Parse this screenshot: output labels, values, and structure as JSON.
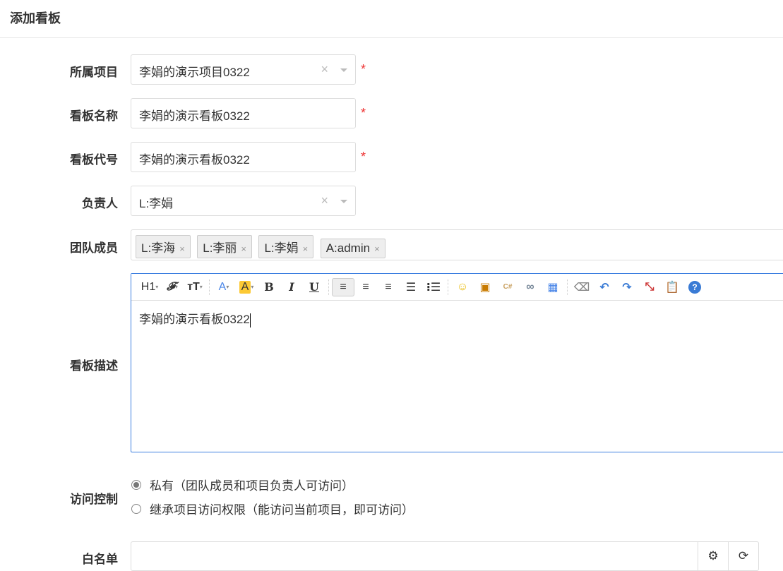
{
  "header": {
    "title": "添加看板"
  },
  "form": {
    "project": {
      "label": "所属项目",
      "value": "李娟的演示项目0322",
      "required": "*"
    },
    "name": {
      "label": "看板名称",
      "value": "李娟的演示看板0322",
      "required": "*"
    },
    "code": {
      "label": "看板代号",
      "value": "李娟的演示看板0322",
      "required": "*"
    },
    "owner": {
      "label": "负责人",
      "value": "L:李娟"
    },
    "team": {
      "label": "团队成员",
      "members": [
        "L:李海",
        "L:李丽",
        "L:李娟",
        "A:admin"
      ]
    },
    "description": {
      "label": "看板描述",
      "value": "李娟的演示看板0322",
      "toolbar": {
        "heading": "H1",
        "font": "𝓕",
        "size": "ᴛT",
        "color": "A",
        "bg": "A",
        "bold": "B",
        "italic": "I",
        "underline": "U"
      }
    },
    "access": {
      "label": "访问控制",
      "options": [
        "私有（团队成员和项目负责人可访问）",
        "继承项目访问权限（能访问当前项目，即可访问）"
      ],
      "selected": 0
    },
    "whitelist": {
      "label": "白名单",
      "value": ""
    }
  },
  "colors": {
    "accent": "#3d7fe0",
    "required": "#ee3333",
    "highlight": "#fcc934"
  }
}
